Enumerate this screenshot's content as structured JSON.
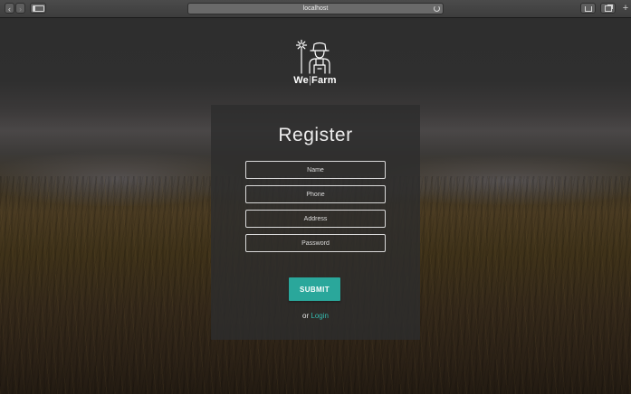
{
  "browser": {
    "url": "localhost",
    "icons": {
      "back": "chevron-left-icon",
      "forward": "chevron-right-icon",
      "sidebar": "sidebar-icon",
      "reload": "reload-icon",
      "share": "share-icon",
      "tabs": "tabs-icon",
      "new_tab": "plus-icon"
    }
  },
  "brand": {
    "name_left": "We",
    "name_sep": "|",
    "name_right": "Farm",
    "logo_icon": "farmer-icon"
  },
  "form": {
    "title": "Register",
    "fields": [
      {
        "placeholder": "Name",
        "value": ""
      },
      {
        "placeholder": "Phone",
        "value": ""
      },
      {
        "placeholder": "Address",
        "value": ""
      },
      {
        "placeholder": "Password",
        "value": ""
      }
    ],
    "submit_label": "SUBMIT",
    "alt_prefix": "or",
    "login_label": "Login"
  },
  "colors": {
    "accent": "#2aa79b",
    "link": "#35b9ad",
    "card_bg": "#2d2d2d"
  }
}
